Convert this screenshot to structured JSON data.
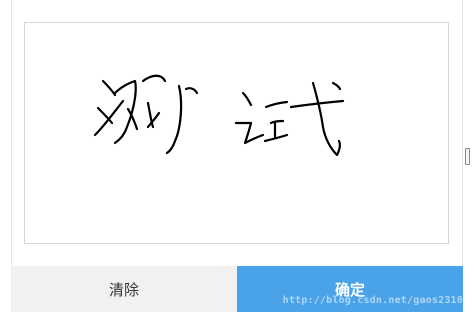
{
  "buttons": {
    "clear_label": "清除",
    "confirm_label": "确定"
  },
  "signature": {
    "handwritten_text": "测试"
  },
  "watermark": "http://blog.csdn.net/gaos2310",
  "colors": {
    "confirm_bg": "#4aa3e8",
    "clear_bg": "#f1f1f1",
    "ink": "#000000"
  }
}
